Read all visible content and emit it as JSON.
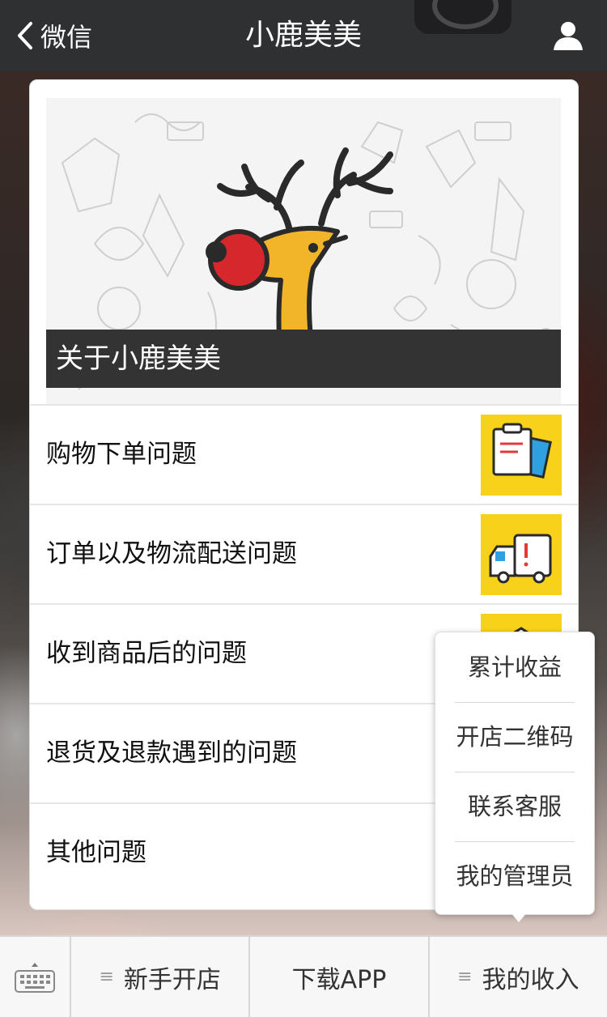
{
  "navbar": {
    "back_label": "微信",
    "title": "小鹿美美",
    "back_icon": "chevron-left-icon",
    "user_icon": "user-icon"
  },
  "banner": {
    "caption": "关于小鹿美美",
    "accent": "#f8d21a"
  },
  "list": {
    "items": [
      {
        "label": "购物下单问题",
        "icon": "clipboard-icon"
      },
      {
        "label": "订单以及物流配送问题",
        "icon": "delivery-truck-icon"
      },
      {
        "label": "收到商品后的问题",
        "icon": "package-icon"
      },
      {
        "label": "退货及退款遇到的问题"
      },
      {
        "label": "其他问题"
      }
    ]
  },
  "popup_menu": {
    "items": [
      "累计收益",
      "开店二维码",
      "联系客服",
      "我的管理员"
    ]
  },
  "bottom_menu": {
    "keyboard_icon": "keyboard-icon",
    "items": [
      "新手开店",
      "下载APP",
      "我的收入"
    ]
  }
}
